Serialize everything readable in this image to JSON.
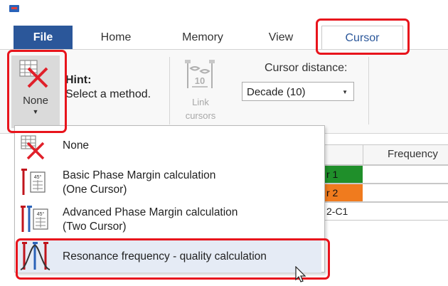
{
  "tabs": {
    "file": "File",
    "home": "Home",
    "memory": "Memory",
    "view": "View",
    "cursor": "Cursor"
  },
  "ribbon": {
    "method_button_label": "None",
    "hint_title": "Hint:",
    "hint_text": "Select a method.",
    "link_cursors_label_1": "Link",
    "link_cursors_label_2": "cursors",
    "cursor_distance_label": "Cursor distance:",
    "cursor_distance_value": "Decade (10)"
  },
  "table": {
    "header": "Frequency",
    "rows": [
      "r 1",
      "r 2",
      "2-C1"
    ]
  },
  "menu": {
    "items": [
      {
        "label": "None"
      },
      {
        "label_1": "Basic Phase Margin calculation",
        "label_2": "(One Cursor)"
      },
      {
        "label_1": "Advanced Phase Margin calculation",
        "label_2": "(Two Cursor)"
      },
      {
        "label": "Resonance frequency - quality calculation"
      }
    ]
  },
  "colors": {
    "file_tab": "#2b579a",
    "highlight": "#e8141c",
    "cursor1": "#1f8f2a",
    "cursor2": "#f07b1e"
  }
}
